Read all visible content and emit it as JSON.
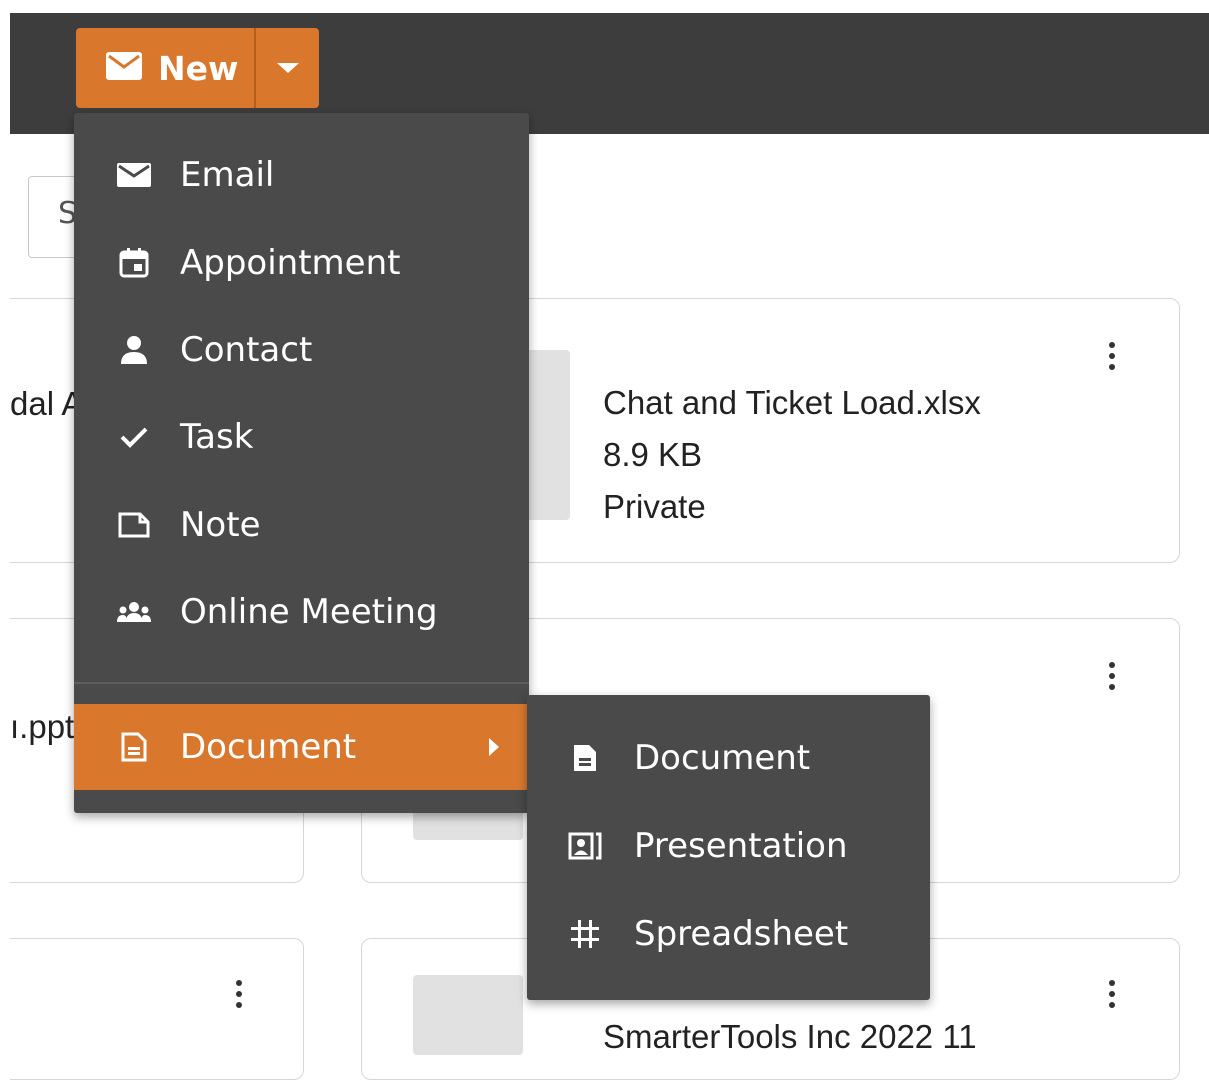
{
  "toolbar": {
    "new_label": "New"
  },
  "search": {
    "visible_text": "S"
  },
  "menu": {
    "items": [
      {
        "label": "Email",
        "icon": "envelope-icon"
      },
      {
        "label": "Appointment",
        "icon": "calendar-icon"
      },
      {
        "label": "Contact",
        "icon": "person-icon"
      },
      {
        "label": "Task",
        "icon": "checkmark-icon"
      },
      {
        "label": "Note",
        "icon": "note-icon"
      },
      {
        "label": "Online Meeting",
        "icon": "people-icon"
      },
      {
        "label": "Document",
        "icon": "document-icon",
        "has_submenu": true
      }
    ]
  },
  "submenu": {
    "items": [
      {
        "label": "Document",
        "icon": "document-icon"
      },
      {
        "label": "Presentation",
        "icon": "presentation-icon"
      },
      {
        "label": "Spreadsheet",
        "icon": "spreadsheet-icon"
      }
    ]
  },
  "cards": {
    "left_fragments": [
      "dal A",
      "ı.ppt"
    ],
    "file1": {
      "name": "Chat and Ticket Load.xlsx",
      "size": "8.9 KB",
      "visibility": "Private"
    },
    "file3": {
      "name_partial": "SmarterTools Inc 2022 11"
    }
  },
  "colors": {
    "accent": "#d9782d",
    "menu_bg": "#4a4a4a",
    "topbar": "#3d3d3d"
  }
}
